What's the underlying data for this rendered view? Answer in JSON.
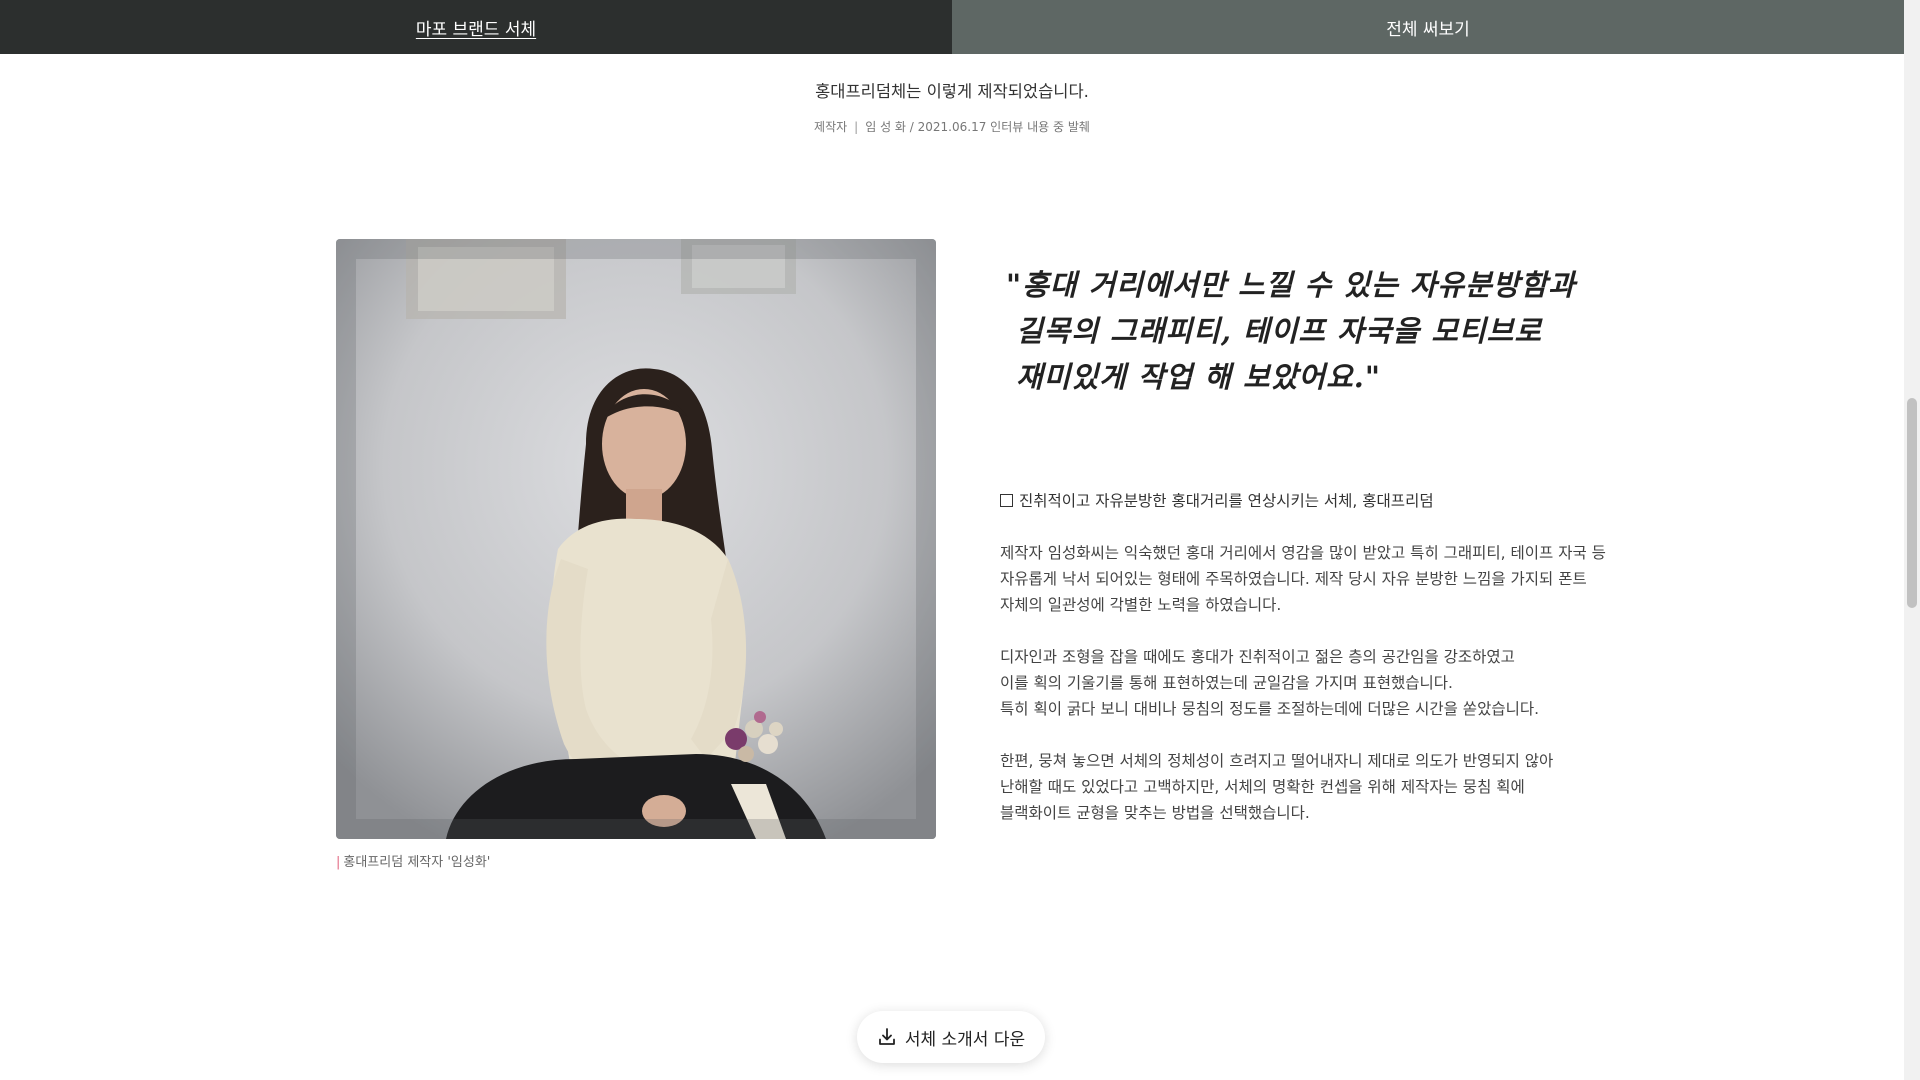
{
  "tabs": [
    {
      "label": "마포 브랜드 서체",
      "active": true
    },
    {
      "label": "전체 써보기",
      "active": false
    }
  ],
  "intro": {
    "title": "홍대프리덤체는 이렇게 제작되었습니다.",
    "role": "제작자",
    "separator": "|",
    "credit": "임 성 화 / 2021.06.17 인터뷰 내용 중 발췌"
  },
  "photo": {
    "caption_marker": "|",
    "caption": "홍대프리덤 제작자 '임성화'"
  },
  "quote": {
    "lines": [
      "\"홍대 거리에서만 느낄 수 있는 자유분방함과",
      "길목의 그래피티, 테이프 자국을 모티브로",
      "재미있게 작업 해 보았어요.\""
    ]
  },
  "body": {
    "heading": "진취적이고 자유분방한 홍대거리를 연상시키는 서체, 홍대프리덤",
    "paragraphs": [
      [
        "제작자 임성화씨는 익숙했던 홍대 거리에서 영감을 많이 받았고 특히 그래피티, 테이프 자국 등",
        "자유롭게 낙서 되어있는 형태에 주목하였습니다. 제작 당시 자유 분방한 느낌을 가지되 폰트",
        "자체의 일관성에 각별한 노력을 하였습니다."
      ],
      [
        "디자인과 조형을 잡을 때에도 홍대가 진취적이고 젊은 층의 공간임을 강조하였고",
        "이를 획의 기울기를 통해 표현하였는데 균일감을 가지며 표현했습니다.",
        "특히 획이 굵다 보니 대비나 뭉침의 정도를 조절하는데에 더많은 시간을 쏟았습니다."
      ],
      [
        "한편, 뭉쳐 놓으면 서체의 정체성이 흐려지고 떨어내자니 제대로 의도가 반영되지 않아",
        "난해할 때도 있었다고 고백하지만, 서체의 명확한 컨셉을 위해 제작자는 뭉침 획에",
        "블랙화이트 균형을 맞추는 방법을 선택했습니다."
      ]
    ]
  },
  "download": {
    "label": "서체 소개서 다운",
    "icon": "download-icon"
  },
  "colors": {
    "tab_active_bg": "#2c2f2e",
    "tab_inactive_bg": "#5e6764",
    "caption_accent": "#e36a84"
  }
}
